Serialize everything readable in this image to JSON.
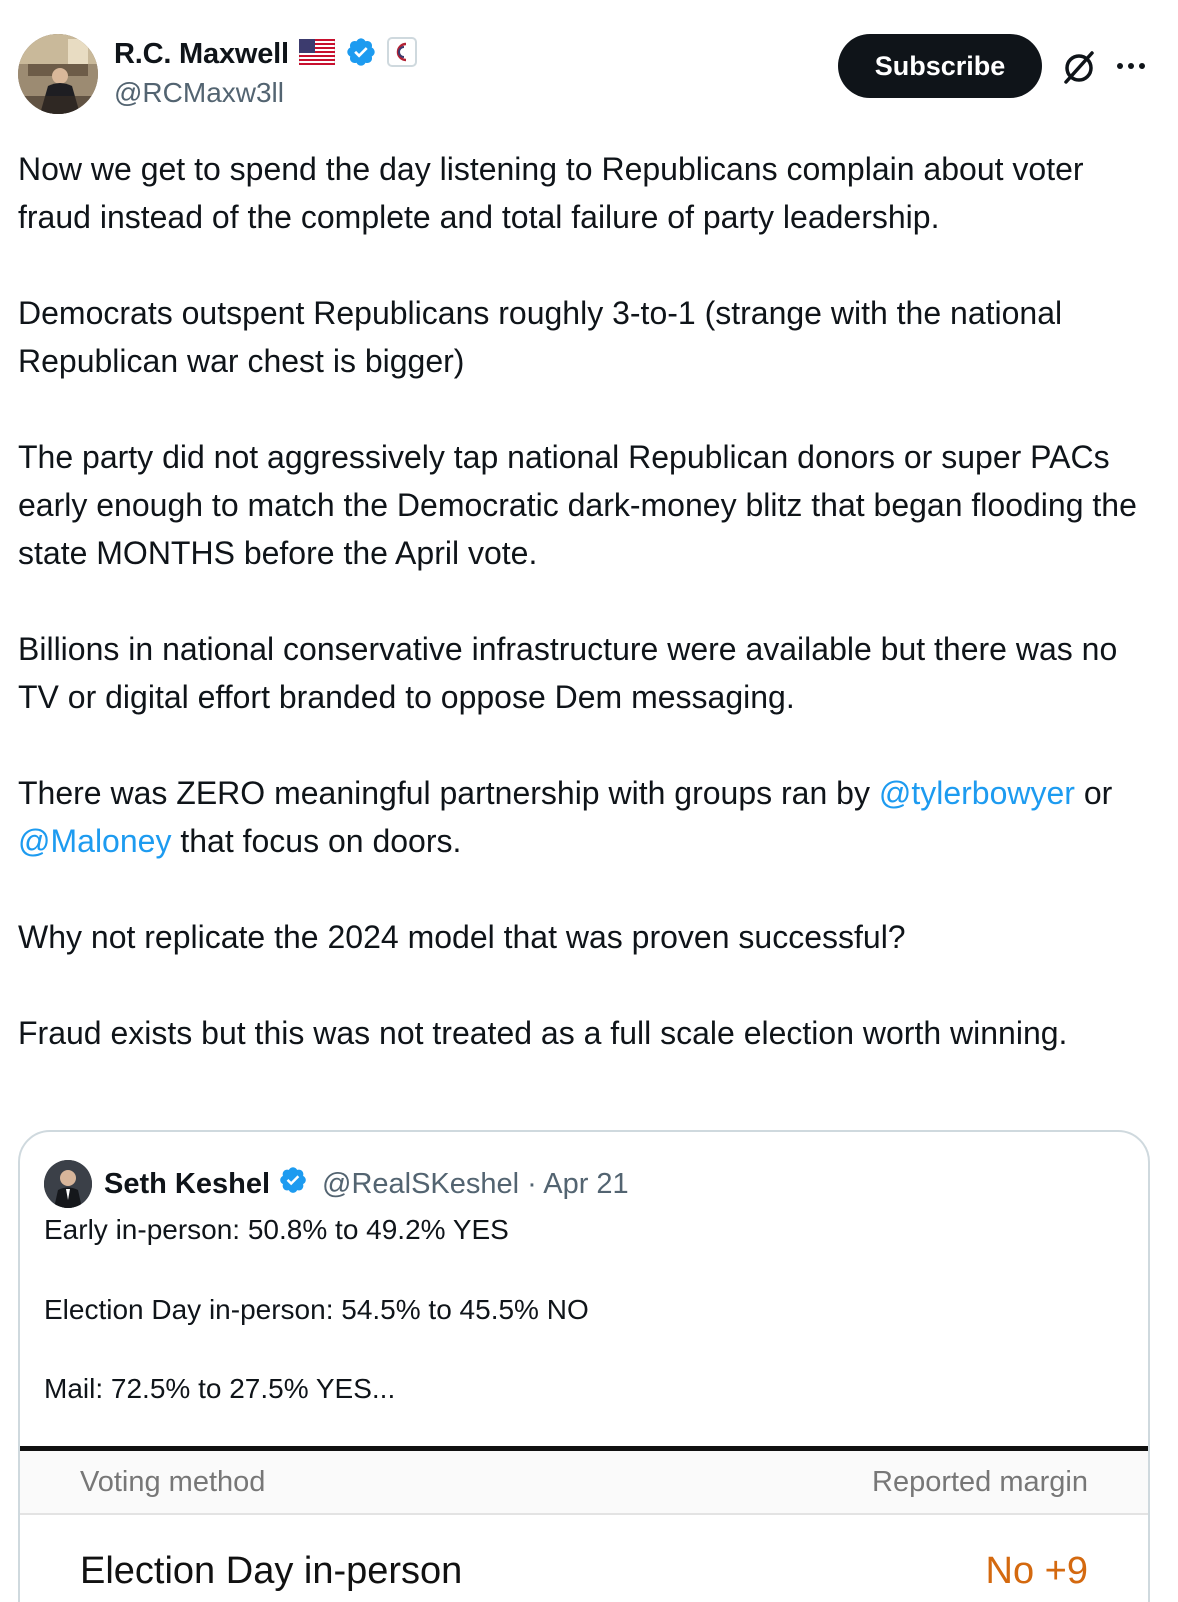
{
  "author": {
    "name": "R.C. Maxwell",
    "handle": "@RCMaxw3ll",
    "flag_emoji": "🇺🇸",
    "verified_icon": "verified-badge-icon",
    "affiliate_icon": "affiliate-badge-icon"
  },
  "actions": {
    "subscribe_label": "Subscribe",
    "grok_icon": "grok-icon",
    "more_icon": "more-icon"
  },
  "body": {
    "p1": "Now we get to spend the day listening to Republicans complain about voter fraud instead of the complete and total failure of party leadership.",
    "p2": "Democrats outspent Republicans roughly 3-to-1 (strange with the national Republican war chest is bigger)",
    "p3": "The party did not aggressively tap national Republican donors or super PACs early enough to match the Democratic dark-money blitz that began flooding the state MONTHS before the April vote.",
    "p4": "Billions in national conservative infrastructure were available but there was no TV or digital effort branded to oppose Dem messaging.",
    "p5_before": "There was ZERO meaningful partnership with groups ran by ",
    "p5_mention1": "@tylerbowyer",
    "p5_middle": " or ",
    "p5_mention2": "@Maloney",
    "p5_after": " that focus on doors.",
    "p6": "Why not replicate the 2024 model that was proven successful?",
    "p7": "Fraud exists but this was not treated as a full scale election worth winning."
  },
  "quote": {
    "name": "Seth Keshel",
    "handle": "@RealSKeshel",
    "date": "· Apr 21",
    "line1": "Early in-person: 50.8% to 49.2% YES",
    "line2": "Election Day in-person: 54.5% to 45.5% NO",
    "line3": "Mail: 72.5% to 27.5% YES...",
    "table": {
      "col_method": "Voting method",
      "col_margin": "Reported margin",
      "row_label": "Election Day in-person",
      "row_value": "No +9"
    }
  },
  "colors": {
    "link": "#1d9bf0",
    "verified": "#1d9bf0",
    "margin_no": "#d4690f"
  }
}
